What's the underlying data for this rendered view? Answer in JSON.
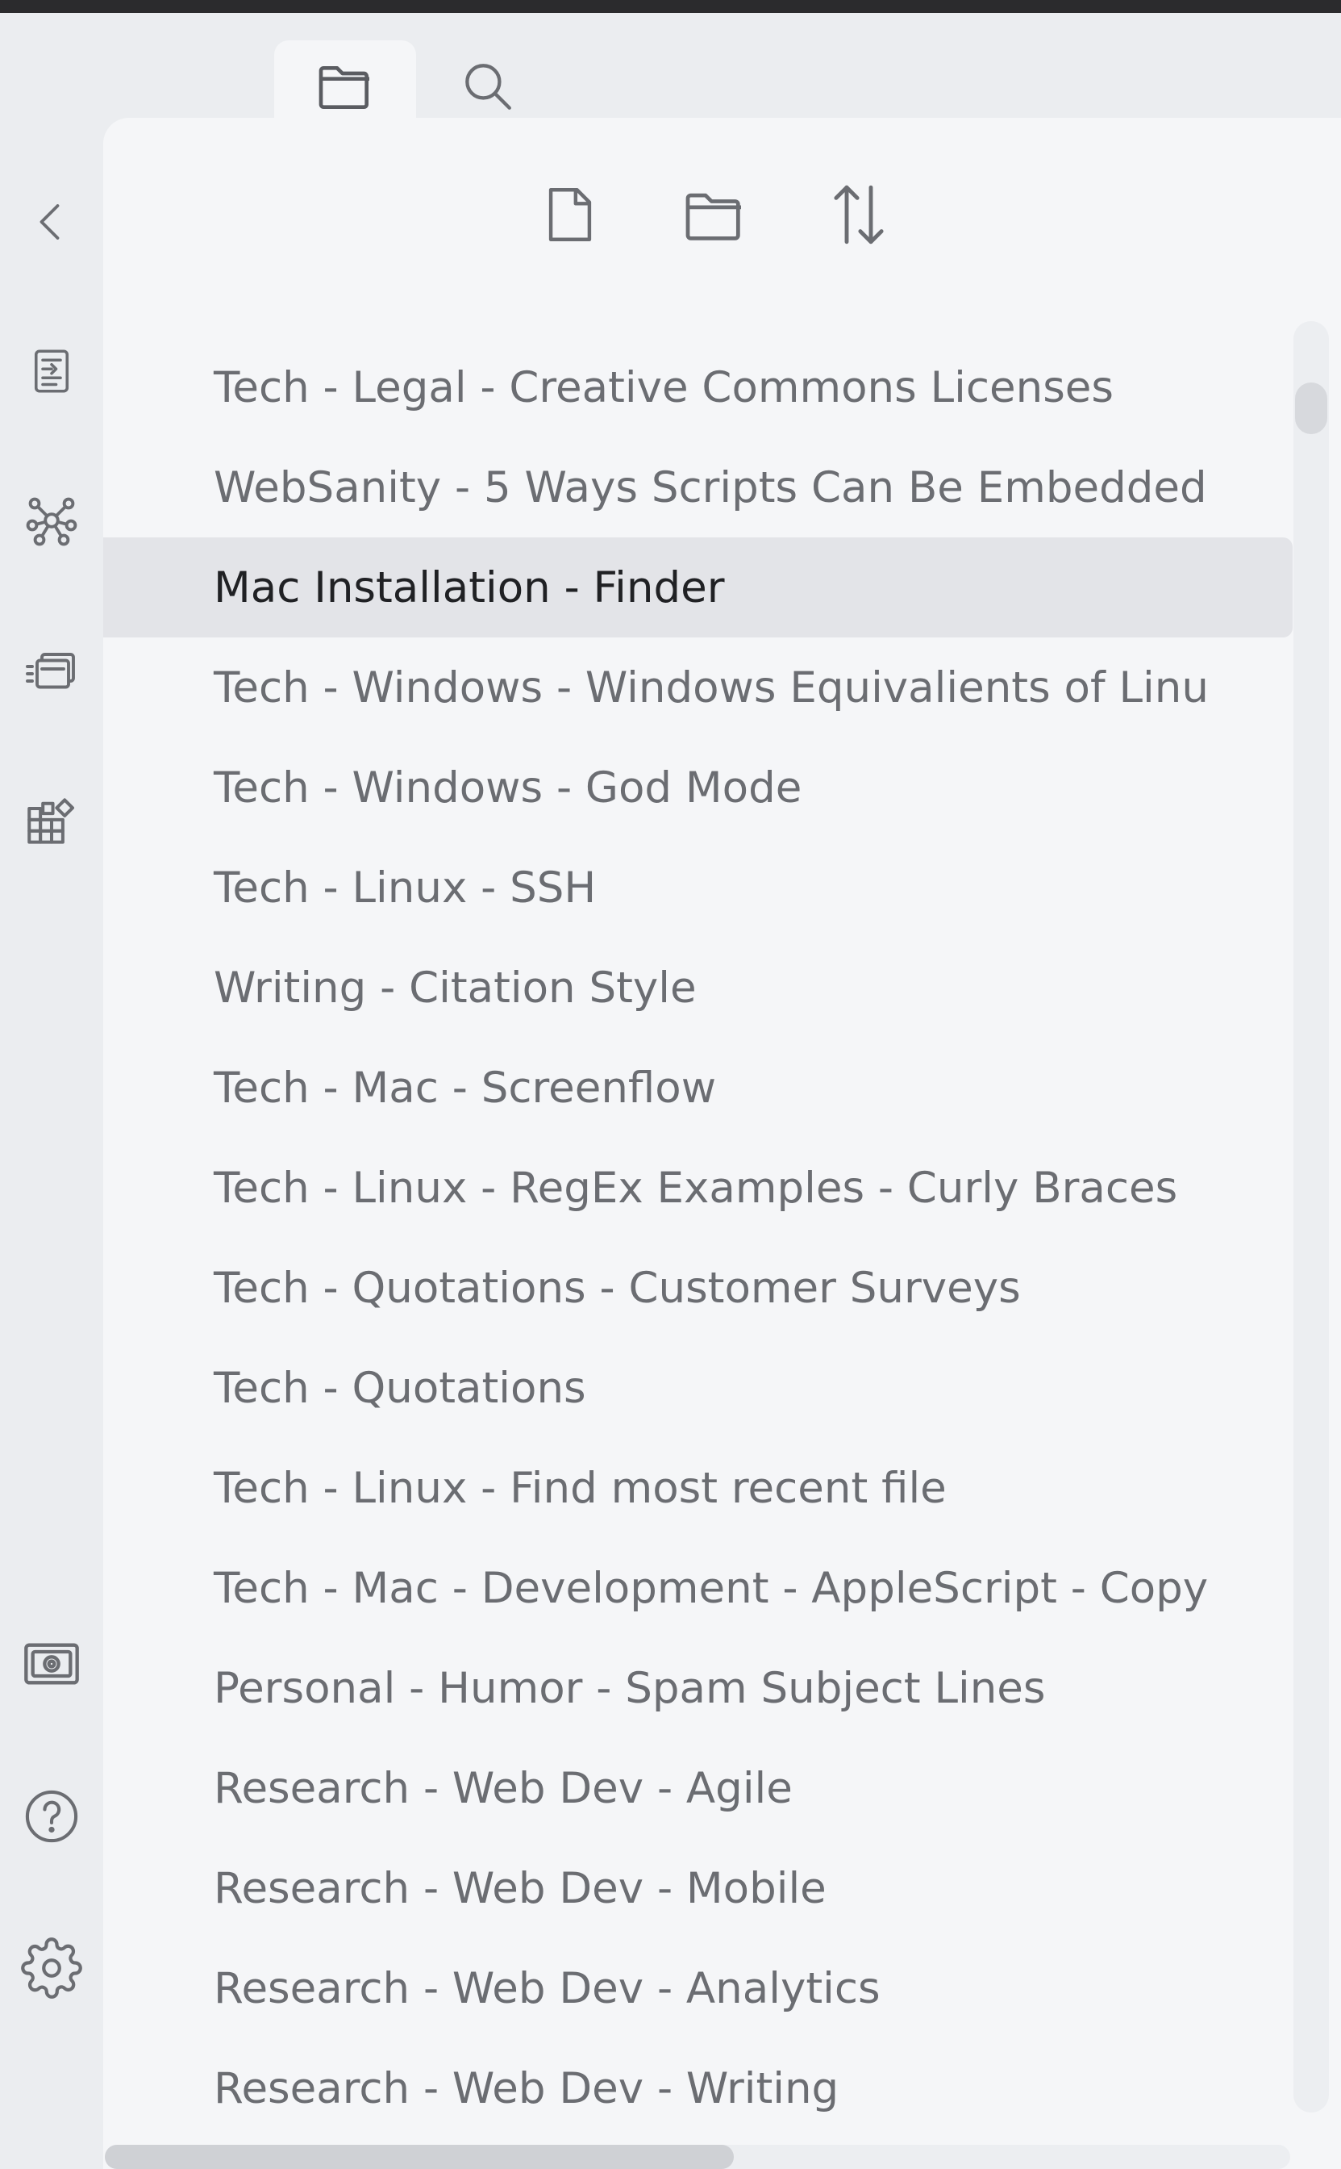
{
  "icons": {
    "files_tab": "folder-tab-icon",
    "search_tab": "search-icon",
    "collapse": "chevron-left-icon",
    "new_note": "new-note-icon",
    "new_folder": "new-folder-icon",
    "sort": "sort-icon",
    "rail": [
      "document-switch-icon",
      "graph-view-icon",
      "slides-icon",
      "community-plugins-icon",
      "vault-icon",
      "help-icon",
      "settings-icon"
    ]
  },
  "colors": {
    "text": "#6b6d72",
    "text_selected": "#202124",
    "selected_bg": "#e3e4e8",
    "panel_bg": "#f5f6f8",
    "rail_bg": "#ebedf0",
    "icon": "#6b6d72"
  },
  "files": [
    "Tech - Legal - Creative Commons Licenses",
    "WebSanity - 5 Ways Scripts Can Be Embedded",
    "Mac Installation - Finder",
    "Tech - Windows - Windows Equivalients of Linu",
    "Tech - Windows - God Mode",
    "Tech - Linux - SSH",
    "Writing - Citation Style",
    "Tech - Mac - Screenflow",
    "Tech - Linux - RegEx Examples - Curly Braces",
    "Tech - Quotations - Customer Surveys",
    "Tech - Quotations",
    "Tech - Linux - Find most recent file",
    "Tech - Mac - Development - AppleScript - Copy",
    "Personal - Humor - Spam Subject Lines",
    "Research - Web Dev - Agile",
    "Research - Web Dev - Mobile",
    "Research - Web Dev - Analytics",
    "Research - Web Dev - Writing"
  ],
  "selected_file": "Mac Installation - Finder"
}
